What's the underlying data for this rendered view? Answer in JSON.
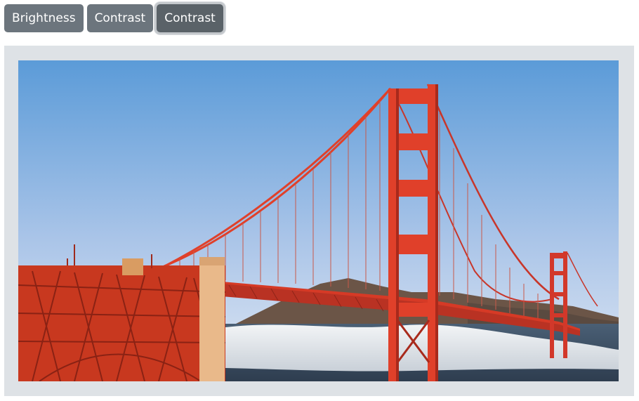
{
  "toolbar": {
    "buttons": [
      {
        "label": "Brightness",
        "active": false
      },
      {
        "label": "Contrast",
        "active": false
      },
      {
        "label": "Contrast",
        "active": true
      }
    ]
  },
  "image": {
    "subject": "Golden Gate Bridge photo",
    "colors": {
      "sky_top": "#5b9bd8",
      "sky_bottom": "#dfe7f3",
      "bridge": "#e0402a",
      "bridge_dark": "#a82a1c",
      "fog": "#e8ecf0",
      "water": "#3a4e63",
      "hills": "#6b5547",
      "pier": "#e9b98a"
    }
  }
}
